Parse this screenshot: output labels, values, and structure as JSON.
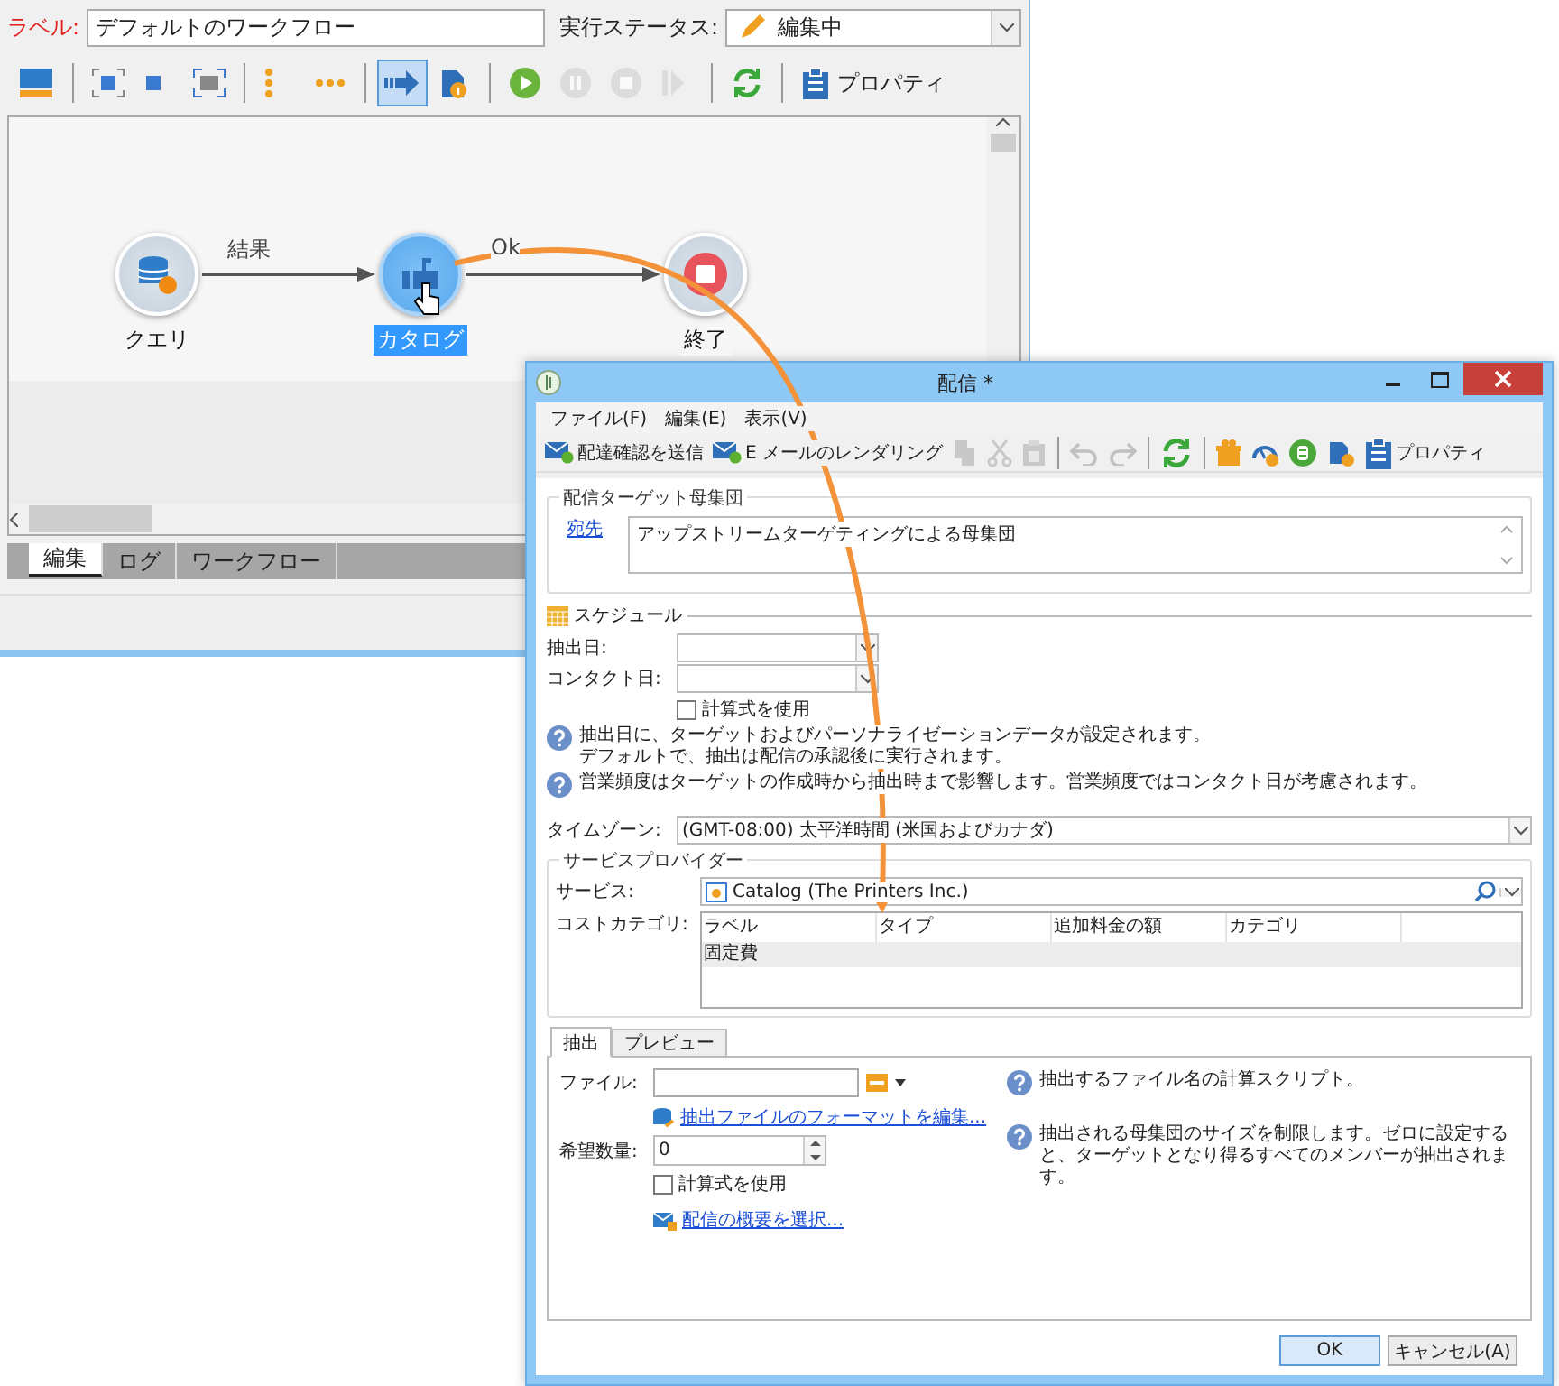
{
  "main_window": {
    "label_caption": "ラベル:",
    "label_value": "デフォルトのワークフロー",
    "status_caption": "実行ステータス:",
    "status_value": "編集中",
    "toolbar": [
      [
        {
          "selected": false,
          "disabled": false
        }
      ],
      [
        {
          "selected": false,
          "disabled": false
        },
        {
          "selected": false,
          "disabled": false
        },
        {
          "selected": false,
          "disabled": false
        }
      ],
      [
        {
          "selected": false,
          "disabled": false
        },
        {
          "selected": false,
          "disabled": false
        }
      ],
      [
        {
          "selected": true,
          "disabled": false
        },
        {
          "selected": false,
          "disabled": false
        }
      ],
      [
        {
          "selected": false,
          "disabled": false
        },
        {
          "selected": false,
          "disabled": true
        },
        {
          "selected": false,
          "disabled": true
        },
        {
          "selected": false,
          "disabled": true
        }
      ],
      [
        {
          "selected": false,
          "disabled": false
        }
      ],
      [
        {
          "selected": false,
          "disabled": false,
          "label": "プロパティ"
        }
      ]
    ],
    "nodes": [
      {
        "kind": "query",
        "label": "クエリ",
        "selected": false
      },
      {
        "kind": "delivery",
        "label": "カタログ",
        "selected": true
      },
      {
        "kind": "end",
        "label": "終了",
        "selected": false
      }
    ],
    "connectors": [
      {
        "label": "結果"
      },
      {
        "label": "Ok"
      }
    ],
    "tabs": [
      {
        "label": "編集",
        "selected": true
      },
      {
        "label": "ログ",
        "selected": false
      },
      {
        "label": "ワークフロー",
        "selected": false
      }
    ]
  },
  "dialog": {
    "title": "配信 *",
    "menu": [
      "ファイル(F)",
      "編集(E)",
      "表示(V)"
    ],
    "toolbar": [
      [
        {
          "kind": "mail",
          "label": "配達確認を送信",
          "disabled": false
        },
        {
          "kind": "mail",
          "label": "E メールのレンダリング",
          "disabled": false
        },
        {
          "kind": "copy",
          "disabled": true
        },
        {
          "kind": "cut",
          "disabled": true
        },
        {
          "kind": "paste",
          "disabled": true
        }
      ],
      [
        {
          "kind": "undo",
          "disabled": true
        },
        {
          "kind": "redo",
          "disabled": true
        }
      ],
      [
        {
          "kind": "refresh",
          "disabled": false
        }
      ],
      [
        {
          "kind": "gift",
          "disabled": false
        },
        {
          "kind": "gauge",
          "disabled": false
        },
        {
          "kind": "database",
          "disabled": false
        },
        {
          "kind": "clip",
          "disabled": false
        },
        {
          "kind": "properties",
          "label": "プロパティ",
          "disabled": false
        }
      ]
    ],
    "target": {
      "legend": "配信ターゲット母集団",
      "link": "宛先",
      "value": "アップストリームターゲティングによる母集団"
    },
    "schedule": {
      "heading": "スケジュール",
      "extraction_label": "抽出日:",
      "contact_label": "コンタクト日:",
      "formula": {
        "label": "計算式を使用",
        "checked": false
      },
      "notes": [
        {
          "lines": [
            "抽出日に、ターゲットおよびパーソナライゼーションデータが設定されます。",
            "デフォルトで、抽出は配信の承認後に実行されます。"
          ]
        },
        {
          "lines": [
            "営業頻度はターゲットの作成時から抽出時まで影響します。営業頻度ではコンタクト日が考慮されます。"
          ]
        }
      ]
    },
    "timezone": {
      "label": "タイムゾーン:",
      "value": "(GMT-08:00) 太平洋時間 (米国およびカナダ)"
    },
    "provider": {
      "legend": "サービスプロバイダー",
      "service_label": "サービス:",
      "service_value": "Catalog (The Printers Inc.)",
      "cost_label": "コストカテゴリ:",
      "columns": [
        "ラベル",
        "タイプ",
        "追加料金の額",
        "カテゴリ"
      ],
      "rows": [
        {
          "cells": [
            "固定費"
          ],
          "selected": true
        }
      ]
    },
    "tabs": [
      {
        "label": "抽出",
        "selected": true
      },
      {
        "label": "プレビュー",
        "selected": false
      }
    ],
    "extraction": {
      "file_label": "ファイル:",
      "file_help": "抽出するファイル名の計算スクリプト。",
      "format_link": "抽出ファイルのフォーマットを編集...",
      "quantity_label": "希望数量:",
      "quantity_value": "0",
      "quantity_help": "抽出される母集団のサイズを制限します。ゼロに設定すると、ターゲットとなり得るすべてのメンバーが抽出されます。",
      "formula": {
        "label": "計算式を使用",
        "checked": false
      },
      "summary_link": "配信の概要を選択..."
    },
    "buttons": [
      {
        "label": "OK",
        "default": true
      },
      {
        "label": "キャンセル(A)",
        "default": false
      }
    ]
  }
}
